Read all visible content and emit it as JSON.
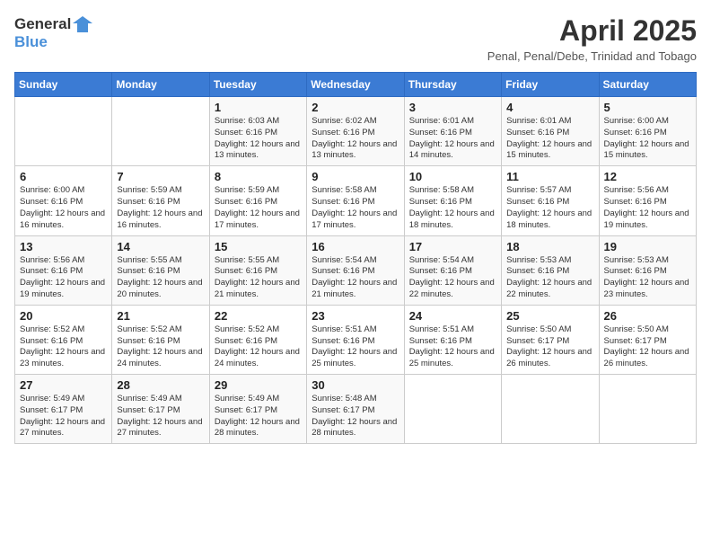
{
  "header": {
    "logo_general": "General",
    "logo_blue": "Blue",
    "month_title": "April 2025",
    "subtitle": "Penal, Penal/Debe, Trinidad and Tobago"
  },
  "days_of_week": [
    "Sunday",
    "Monday",
    "Tuesday",
    "Wednesday",
    "Thursday",
    "Friday",
    "Saturday"
  ],
  "weeks": [
    [
      {
        "day": "",
        "info": ""
      },
      {
        "day": "",
        "info": ""
      },
      {
        "day": "1",
        "info": "Sunrise: 6:03 AM\nSunset: 6:16 PM\nDaylight: 12 hours and 13 minutes."
      },
      {
        "day": "2",
        "info": "Sunrise: 6:02 AM\nSunset: 6:16 PM\nDaylight: 12 hours and 13 minutes."
      },
      {
        "day": "3",
        "info": "Sunrise: 6:01 AM\nSunset: 6:16 PM\nDaylight: 12 hours and 14 minutes."
      },
      {
        "day": "4",
        "info": "Sunrise: 6:01 AM\nSunset: 6:16 PM\nDaylight: 12 hours and 15 minutes."
      },
      {
        "day": "5",
        "info": "Sunrise: 6:00 AM\nSunset: 6:16 PM\nDaylight: 12 hours and 15 minutes."
      }
    ],
    [
      {
        "day": "6",
        "info": "Sunrise: 6:00 AM\nSunset: 6:16 PM\nDaylight: 12 hours and 16 minutes."
      },
      {
        "day": "7",
        "info": "Sunrise: 5:59 AM\nSunset: 6:16 PM\nDaylight: 12 hours and 16 minutes."
      },
      {
        "day": "8",
        "info": "Sunrise: 5:59 AM\nSunset: 6:16 PM\nDaylight: 12 hours and 17 minutes."
      },
      {
        "day": "9",
        "info": "Sunrise: 5:58 AM\nSunset: 6:16 PM\nDaylight: 12 hours and 17 minutes."
      },
      {
        "day": "10",
        "info": "Sunrise: 5:58 AM\nSunset: 6:16 PM\nDaylight: 12 hours and 18 minutes."
      },
      {
        "day": "11",
        "info": "Sunrise: 5:57 AM\nSunset: 6:16 PM\nDaylight: 12 hours and 18 minutes."
      },
      {
        "day": "12",
        "info": "Sunrise: 5:56 AM\nSunset: 6:16 PM\nDaylight: 12 hours and 19 minutes."
      }
    ],
    [
      {
        "day": "13",
        "info": "Sunrise: 5:56 AM\nSunset: 6:16 PM\nDaylight: 12 hours and 19 minutes."
      },
      {
        "day": "14",
        "info": "Sunrise: 5:55 AM\nSunset: 6:16 PM\nDaylight: 12 hours and 20 minutes."
      },
      {
        "day": "15",
        "info": "Sunrise: 5:55 AM\nSunset: 6:16 PM\nDaylight: 12 hours and 21 minutes."
      },
      {
        "day": "16",
        "info": "Sunrise: 5:54 AM\nSunset: 6:16 PM\nDaylight: 12 hours and 21 minutes."
      },
      {
        "day": "17",
        "info": "Sunrise: 5:54 AM\nSunset: 6:16 PM\nDaylight: 12 hours and 22 minutes."
      },
      {
        "day": "18",
        "info": "Sunrise: 5:53 AM\nSunset: 6:16 PM\nDaylight: 12 hours and 22 minutes."
      },
      {
        "day": "19",
        "info": "Sunrise: 5:53 AM\nSunset: 6:16 PM\nDaylight: 12 hours and 23 minutes."
      }
    ],
    [
      {
        "day": "20",
        "info": "Sunrise: 5:52 AM\nSunset: 6:16 PM\nDaylight: 12 hours and 23 minutes."
      },
      {
        "day": "21",
        "info": "Sunrise: 5:52 AM\nSunset: 6:16 PM\nDaylight: 12 hours and 24 minutes."
      },
      {
        "day": "22",
        "info": "Sunrise: 5:52 AM\nSunset: 6:16 PM\nDaylight: 12 hours and 24 minutes."
      },
      {
        "day": "23",
        "info": "Sunrise: 5:51 AM\nSunset: 6:16 PM\nDaylight: 12 hours and 25 minutes."
      },
      {
        "day": "24",
        "info": "Sunrise: 5:51 AM\nSunset: 6:16 PM\nDaylight: 12 hours and 25 minutes."
      },
      {
        "day": "25",
        "info": "Sunrise: 5:50 AM\nSunset: 6:17 PM\nDaylight: 12 hours and 26 minutes."
      },
      {
        "day": "26",
        "info": "Sunrise: 5:50 AM\nSunset: 6:17 PM\nDaylight: 12 hours and 26 minutes."
      }
    ],
    [
      {
        "day": "27",
        "info": "Sunrise: 5:49 AM\nSunset: 6:17 PM\nDaylight: 12 hours and 27 minutes."
      },
      {
        "day": "28",
        "info": "Sunrise: 5:49 AM\nSunset: 6:17 PM\nDaylight: 12 hours and 27 minutes."
      },
      {
        "day": "29",
        "info": "Sunrise: 5:49 AM\nSunset: 6:17 PM\nDaylight: 12 hours and 28 minutes."
      },
      {
        "day": "30",
        "info": "Sunrise: 5:48 AM\nSunset: 6:17 PM\nDaylight: 12 hours and 28 minutes."
      },
      {
        "day": "",
        "info": ""
      },
      {
        "day": "",
        "info": ""
      },
      {
        "day": "",
        "info": ""
      }
    ]
  ]
}
